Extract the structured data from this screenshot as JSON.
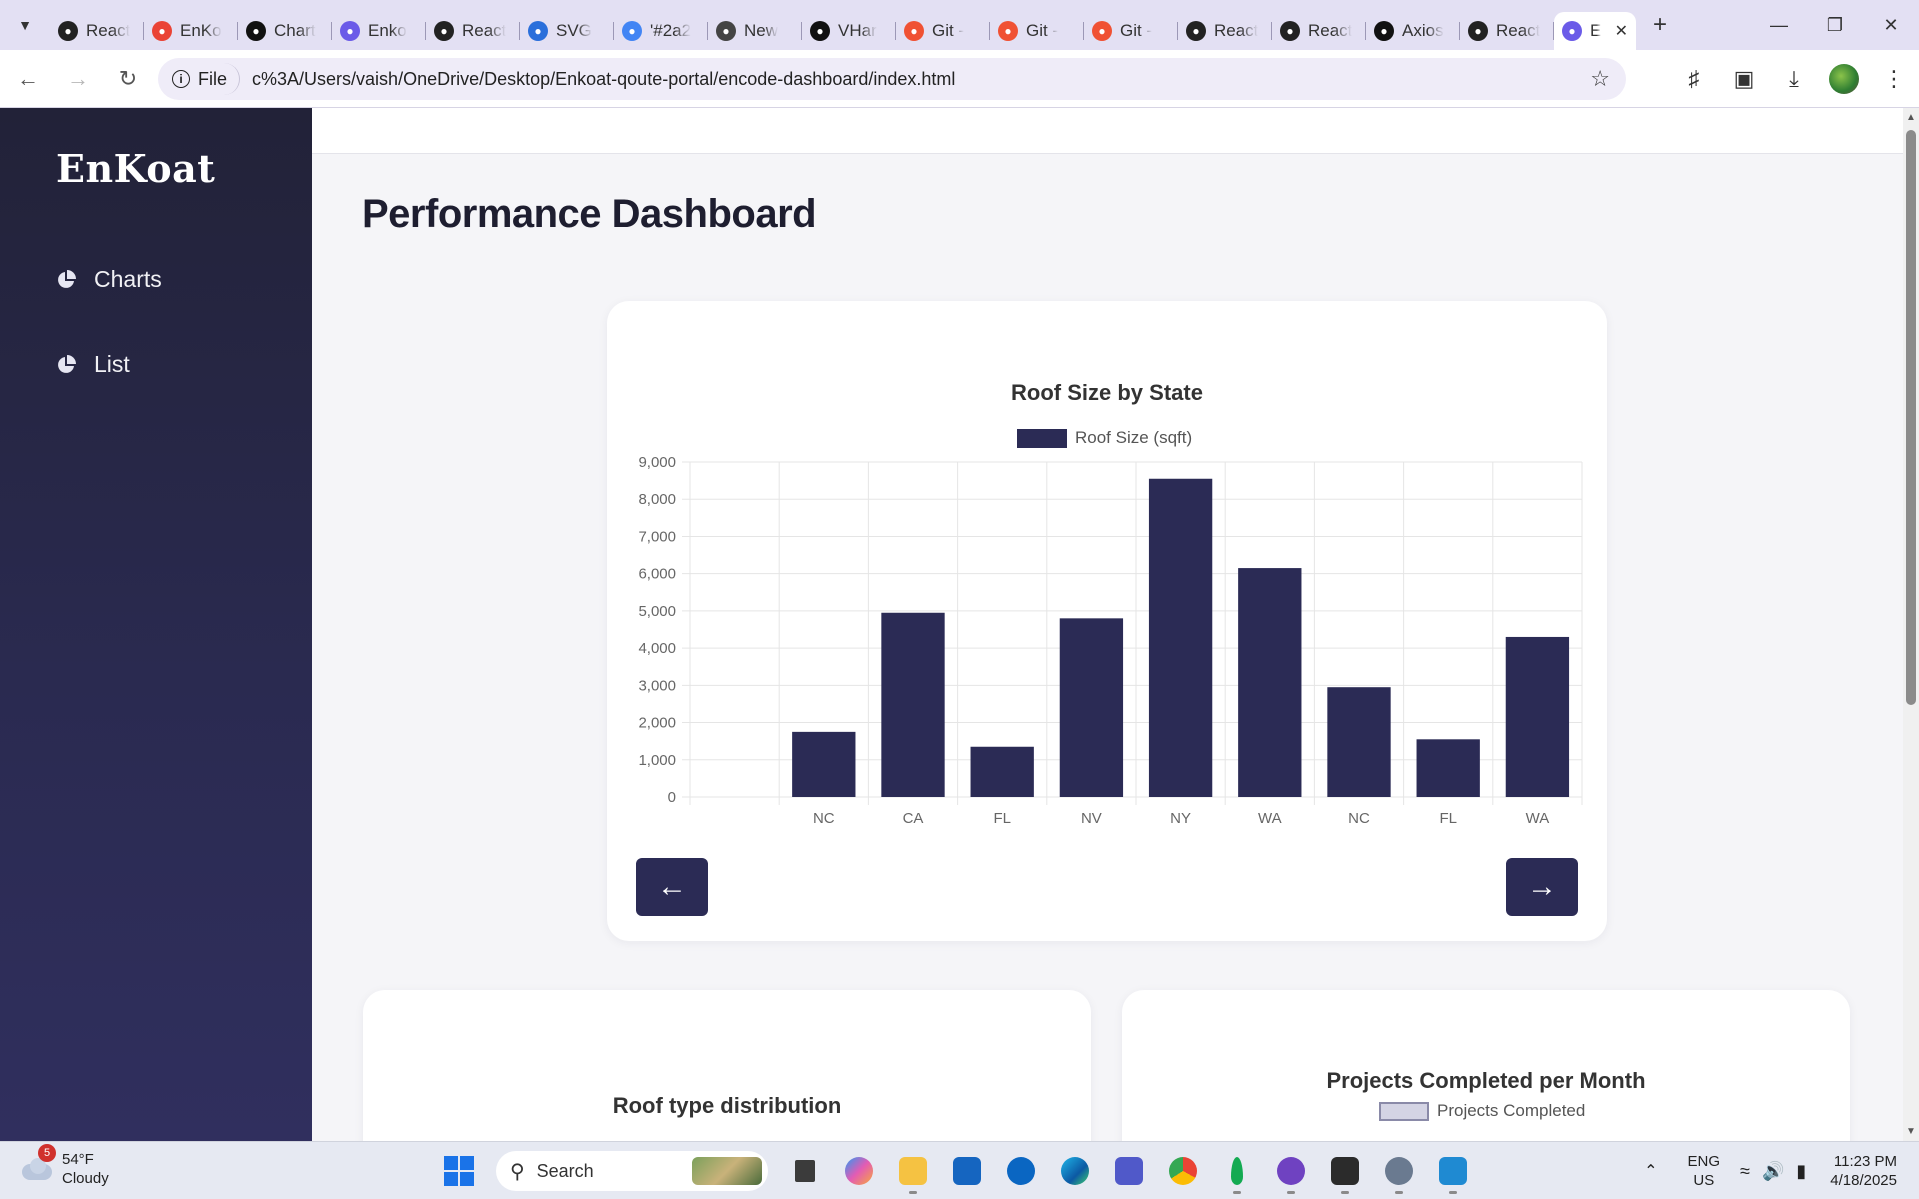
{
  "browser": {
    "tabs": [
      {
        "title": "React",
        "icon": "react-icon",
        "color": "#222222"
      },
      {
        "title": "EnKo",
        "icon": "gmail-icon",
        "color": "#ea4335"
      },
      {
        "title": "Chart",
        "icon": "openai-icon",
        "color": "#111111"
      },
      {
        "title": "Enko",
        "icon": "copilot-icon",
        "color": "#6b5be8"
      },
      {
        "title": "React",
        "icon": "react-icon",
        "color": "#222222"
      },
      {
        "title": "SVG",
        "icon": "w3schools-icon",
        "color": "#2a6fdb"
      },
      {
        "title": "'#2a2",
        "icon": "google-icon",
        "color": "#4285f4"
      },
      {
        "title": "New",
        "icon": "chrome-icon",
        "color": "#444444"
      },
      {
        "title": "VHar",
        "icon": "github-icon",
        "color": "#111111"
      },
      {
        "title": "Git -",
        "icon": "git-icon",
        "color": "#f05133"
      },
      {
        "title": "Git -",
        "icon": "git-icon",
        "color": "#f05133"
      },
      {
        "title": "Git -",
        "icon": "git-icon",
        "color": "#f05133"
      },
      {
        "title": "React",
        "icon": "react-icon",
        "color": "#222222"
      },
      {
        "title": "React",
        "icon": "react-icon",
        "color": "#222222"
      },
      {
        "title": "Axios",
        "icon": "openai-icon",
        "color": "#111111"
      },
      {
        "title": "React",
        "icon": "react-icon",
        "color": "#222222"
      }
    ],
    "active_tab": {
      "title": "E",
      "icon": "copilot-icon",
      "color": "#6b5be8"
    },
    "address": {
      "scheme_label": "File",
      "url": "c%3A/Users/vaish/OneDrive/Desktop/Enkoat-qoute-portal/encode-dashboard/index.html"
    }
  },
  "sidebar": {
    "logo": "EnKoat",
    "items": [
      {
        "label": "Charts",
        "icon": "pie-chart-icon"
      },
      {
        "label": "List",
        "icon": "pie-chart-icon"
      }
    ]
  },
  "page": {
    "title": "Performance Dashboard",
    "prev_label": "←",
    "next_label": "→"
  },
  "cards": {
    "left_title": "Roof type distribution",
    "right_title": "Projects Completed per Month",
    "right_legend": "Projects Completed",
    "right_legend_color": "#d4d4e4"
  },
  "chart_data": {
    "type": "bar",
    "title": "Roof Size by State",
    "legend": "Roof Size (sqft)",
    "color": "#2b2b55",
    "categories": [
      "",
      "NC",
      "CA",
      "FL",
      "NV",
      "NY",
      "WA",
      "NC",
      "FL",
      "WA"
    ],
    "values": [
      0,
      1750,
      4950,
      1350,
      4800,
      8550,
      6150,
      2950,
      1550,
      4300
    ],
    "ylim": [
      0,
      9000
    ],
    "yticks": [
      "0",
      "1,000",
      "2,000",
      "3,000",
      "4,000",
      "5,000",
      "6,000",
      "7,000",
      "8,000",
      "9,000"
    ],
    "grid": true,
    "legend_position": "top"
  },
  "taskbar": {
    "weather_badge": "5",
    "temp": "54°F",
    "condition": "Cloudy",
    "search_placeholder": "Search",
    "lang_top": "ENG",
    "lang_bottom": "US",
    "time": "11:23 PM",
    "date": "4/18/2025"
  }
}
